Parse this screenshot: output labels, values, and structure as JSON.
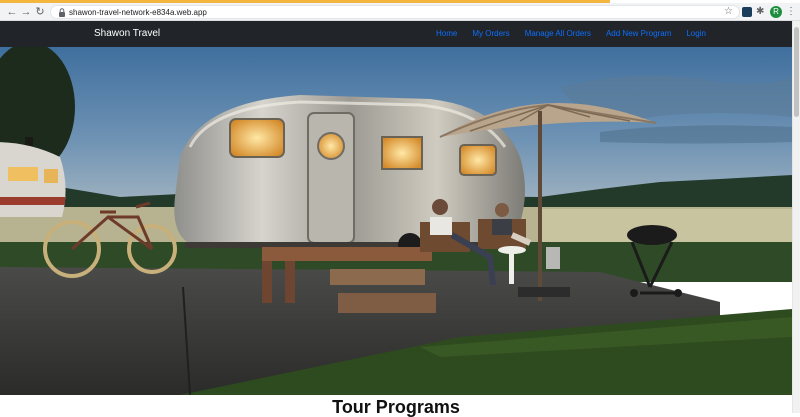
{
  "browser": {
    "url": "shawon-travel-network-e834a.web.app",
    "profile_initial": "R"
  },
  "site": {
    "brand": "Shawon Travel",
    "nav": [
      {
        "label": "Home"
      },
      {
        "label": "My Orders"
      },
      {
        "label": "Manage All Orders"
      },
      {
        "label": "Add New Program"
      },
      {
        "label": "Login"
      }
    ],
    "section_title": "Tour Programs"
  },
  "colors": {
    "navbar": "#212529",
    "link": "#0d6efd",
    "accent": "#f4b63f"
  },
  "icons": [
    "back-icon",
    "forward-icon",
    "reload-icon",
    "lock-icon",
    "bookmark-star-icon",
    "extension-icon",
    "puzzle-icon",
    "profile-avatar",
    "menu-dots-icon"
  ]
}
